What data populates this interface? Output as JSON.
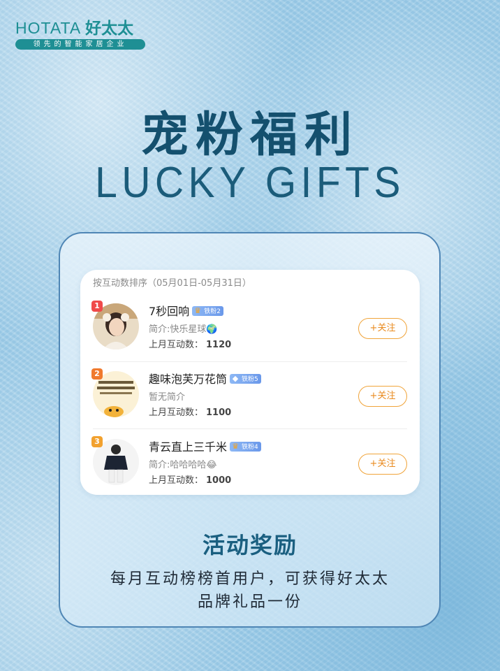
{
  "brand": {
    "name_en": "HOTATA",
    "name_cn": "好太太",
    "tagline": "领先的智能家居企业"
  },
  "header": {
    "title_cn": "宠粉福利",
    "title_en": "LUCKY GIFTS"
  },
  "ranking": {
    "sort_label": "按互动数排序（05月01日-05月31日）",
    "count_label": "上月互动数：",
    "follow_label": "+关注",
    "items": [
      {
        "rank": "1",
        "rank_color": "#f04a4a",
        "name": "7秒回响",
        "badge": "铁粉2",
        "bio": "简介:快乐星球🌍",
        "count": "1120"
      },
      {
        "rank": "2",
        "rank_color": "#f07a2e",
        "name": "趣味泡芙万花筒",
        "badge": "铁粉5",
        "bio": "暂无简介",
        "count": "1100"
      },
      {
        "rank": "3",
        "rank_color": "#f2a12e",
        "name": "青云直上三千米",
        "badge": "铁粉4",
        "bio": "简介:哈哈哈哈😂",
        "count": "1000"
      }
    ]
  },
  "reward": {
    "title": "活动奖励",
    "line1": "每月互动榜榜首用户，可获得好太太",
    "line2": "品牌礼品一份"
  }
}
